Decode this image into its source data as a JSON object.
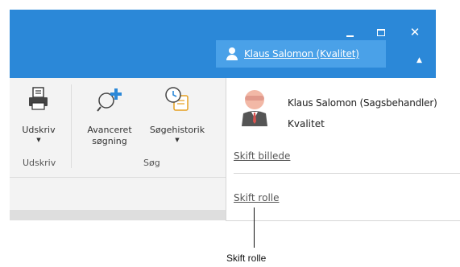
{
  "titlebar": {
    "user_link": "Klaus Salomon (Kvalitet)",
    "minimize_glyph": "",
    "maximize_glyph": "",
    "close_glyph": "✕",
    "collapse_glyph": "▲",
    "color": "#2b88d8",
    "tab_color": "#4aa1e8"
  },
  "ribbon": {
    "print": {
      "label": "Udskriv",
      "arrow": "▼",
      "group": "Udskriv",
      "icon": "printer-icon"
    },
    "advanced_search": {
      "label_line1": "Avanceret",
      "label_line2": "søgning",
      "icon": "search-plus-icon"
    },
    "search_history": {
      "label": "Søgehistorik",
      "arrow": "▼",
      "icon": "clock-history-icon"
    },
    "search_group": "Søg"
  },
  "panel": {
    "name": "Klaus Salomon (Sagsbehandler)",
    "role": "Kvalitet",
    "change_picture": "Skift billede",
    "change_role": "Skift rolle"
  },
  "callout": {
    "text": "Skift rolle"
  }
}
